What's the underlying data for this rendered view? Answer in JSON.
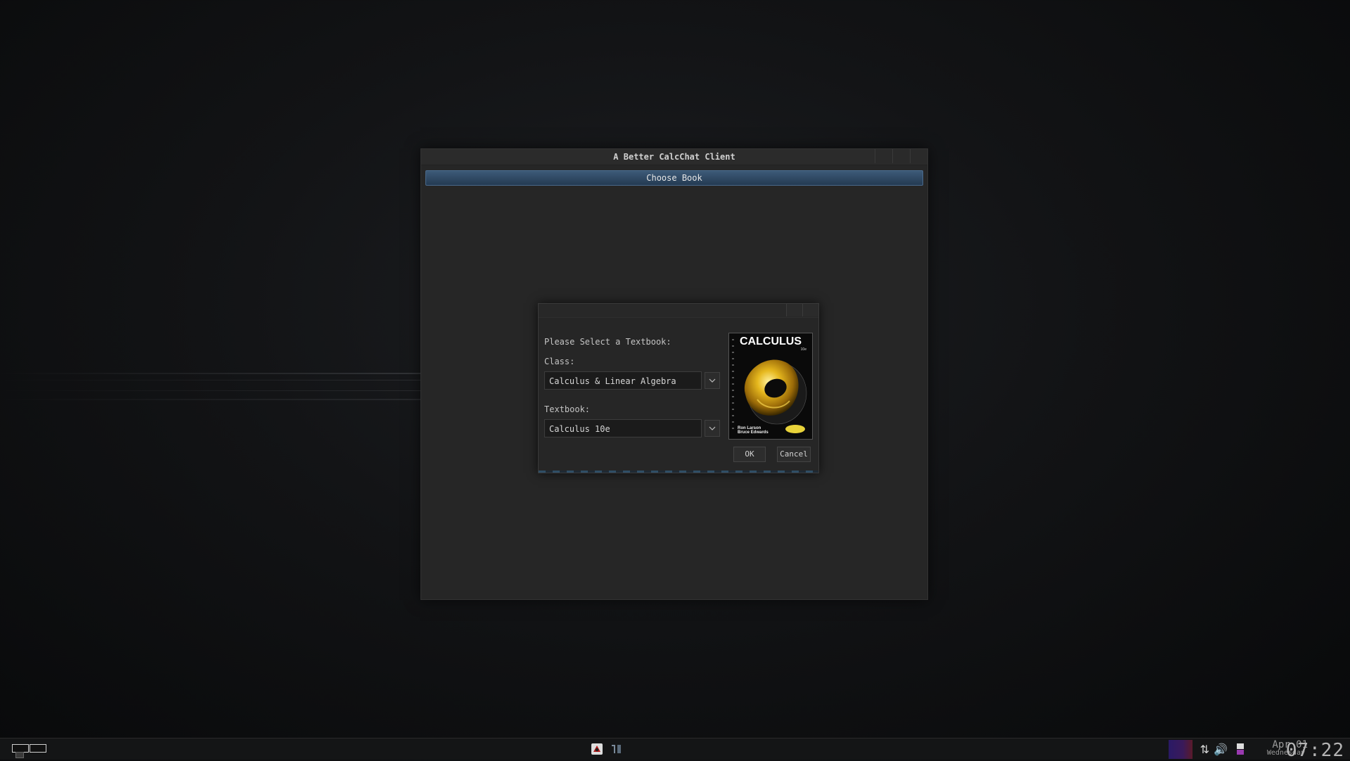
{
  "main_window": {
    "title": "A Better CalcChat Client",
    "tab_label": "Choose Book"
  },
  "dialog": {
    "prompt": "Please Select a Textbook:",
    "class_label": "Class:",
    "class_value": "Calculus & Linear Algebra",
    "textbook_label": "Textbook:",
    "textbook_value": "Calculus 10e",
    "ok_label": "OK",
    "cancel_label": "Cancel",
    "cover": {
      "title": "CALCULUS",
      "edition": "10e",
      "author_1": "Ron Larson",
      "author_2": "Bruce Edwards"
    }
  },
  "taskbar": {
    "date": "Apr 01",
    "weekday": "Wednesday",
    "time": "07:22",
    "icons": [
      "app-icon-1",
      "app-icon-2",
      "network-icon",
      "volume-icon",
      "calendar-icon"
    ]
  }
}
